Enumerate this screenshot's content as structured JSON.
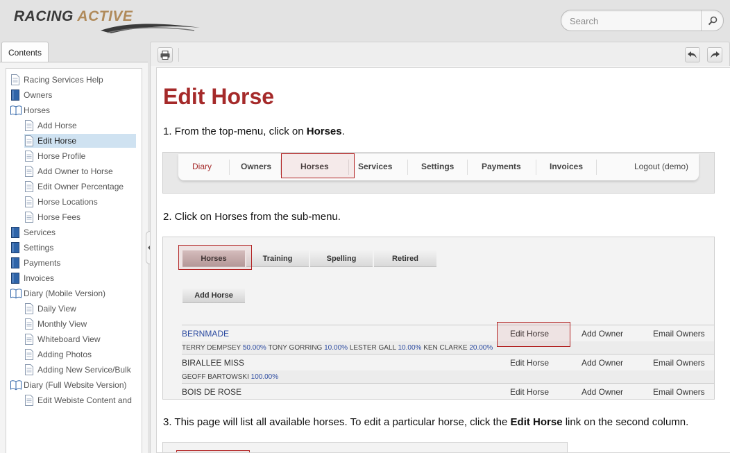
{
  "header": {
    "logo_word1": "RACING",
    "logo_word2": "ACTIVE",
    "search_placeholder": "Search"
  },
  "left_tab": {
    "label": "Contents"
  },
  "toc": [
    {
      "label": "Racing Services Help",
      "level": 0,
      "icon": "page-icon"
    },
    {
      "label": "Owners",
      "level": 0,
      "icon": "book-closed-icon"
    },
    {
      "label": "Horses",
      "level": 0,
      "icon": "book-open-icon"
    },
    {
      "label": "Add Horse",
      "level": 1,
      "icon": "page-icon"
    },
    {
      "label": "Edit Horse",
      "level": 1,
      "icon": "page-icon",
      "selected": true
    },
    {
      "label": "Horse Profile",
      "level": 1,
      "icon": "page-icon"
    },
    {
      "label": "Add Owner to Horse",
      "level": 1,
      "icon": "page-icon"
    },
    {
      "label": "Edit Owner Percentage",
      "level": 1,
      "icon": "page-icon"
    },
    {
      "label": "Horse Locations",
      "level": 1,
      "icon": "page-icon"
    },
    {
      "label": "Horse Fees",
      "level": 1,
      "icon": "page-icon"
    },
    {
      "label": "Services",
      "level": 0,
      "icon": "book-closed-icon"
    },
    {
      "label": "Settings",
      "level": 0,
      "icon": "book-closed-icon"
    },
    {
      "label": "Payments",
      "level": 0,
      "icon": "book-closed-icon"
    },
    {
      "label": "Invoices",
      "level": 0,
      "icon": "book-closed-icon"
    },
    {
      "label": "Diary (Mobile Version)",
      "level": 0,
      "icon": "book-open-icon"
    },
    {
      "label": "Daily View",
      "level": 1,
      "icon": "page-icon"
    },
    {
      "label": "Monthly View",
      "level": 1,
      "icon": "page-icon"
    },
    {
      "label": "Whiteboard View",
      "level": 1,
      "icon": "page-icon"
    },
    {
      "label": "Adding Photos",
      "level": 1,
      "icon": "page-icon"
    },
    {
      "label": "Adding New Service/Bulk",
      "level": 1,
      "icon": "page-icon"
    },
    {
      "label": "Diary (Full Website Version)",
      "level": 0,
      "icon": "book-open-icon"
    },
    {
      "label": "Edit Webiste Content and",
      "level": 1,
      "icon": "page-icon"
    }
  ],
  "toolbar": {
    "print_icon": "print-icon",
    "back_icon": "back-arrow-icon",
    "forward_icon": "forward-arrow-icon"
  },
  "article": {
    "title": "Edit Horse",
    "step1_pre": "1. From the top-menu, click on ",
    "step1_bold": "Horses",
    "step1_post": ".",
    "step2": "2. Click on Horses from the sub-menu.",
    "step3_pre": "3. This page will list all available horses. To edit a particular horse, click the ",
    "step3_bold": "Edit Horse",
    "step3_post": " link on the second column."
  },
  "shot1": {
    "menu": [
      "Diary",
      "Owners",
      "Horses",
      "Services",
      "Settings",
      "Payments",
      "Invoices"
    ],
    "logout": "Logout (demo)"
  },
  "shot2": {
    "subtabs": [
      "Horses",
      "Training",
      "Spelling",
      "Retired"
    ],
    "add_horse": "Add Horse",
    "rows": [
      {
        "name": "BERNMADE",
        "c1": "Edit Horse",
        "c2": "Add Owner",
        "c3": "Email Owners"
      },
      {
        "name": "BIRALLEE MISS",
        "c1": "Edit Horse",
        "c2": "Add Owner",
        "c3": "Email Owners"
      },
      {
        "name": "BOIS DE ROSE",
        "c1": "Edit Horse",
        "c2": "Add Owner",
        "c3": "Email Owners"
      }
    ],
    "owners1": [
      {
        "n": "TERRY DEMPSEY",
        "p": "50.00%"
      },
      {
        "n": "TONY GORRING",
        "p": "10.00%"
      },
      {
        "n": "LESTER GALL",
        "p": "10.00%"
      },
      {
        "n": "KEN CLARKE",
        "p": "20.00%"
      }
    ],
    "owners2": [
      {
        "n": "GEOFF BARTOWSKI",
        "p": "100.00%"
      }
    ]
  },
  "colors": {
    "accent": "#a52a2a",
    "link": "#2b4aa0",
    "selected": "#cfe2f1"
  }
}
